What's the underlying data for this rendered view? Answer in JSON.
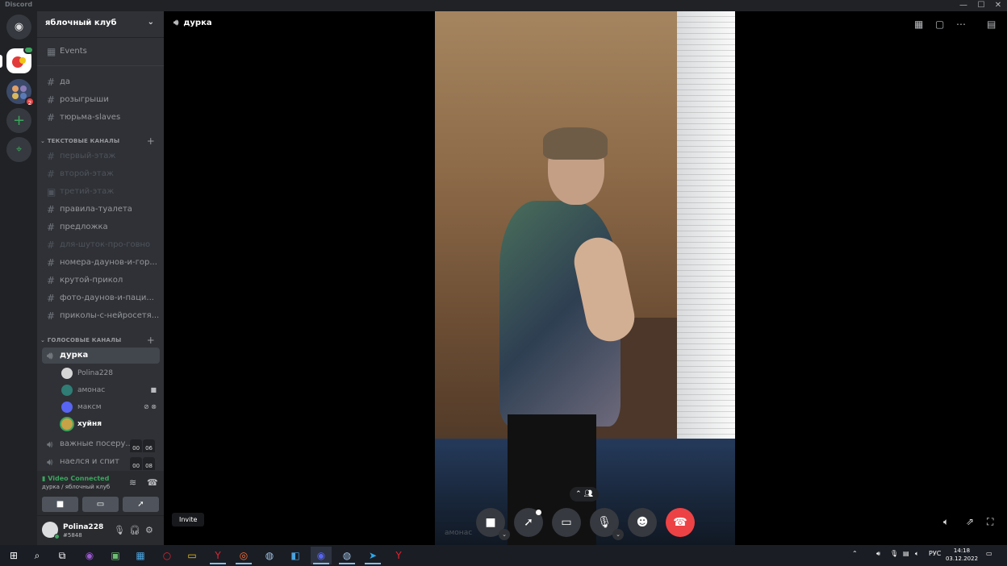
{
  "titlebar": {
    "app": "Discord",
    "minimize": "—",
    "maximize": "☐",
    "close": "✕"
  },
  "guilds": {
    "home": "◉",
    "add": "+",
    "explore": "⌖",
    "g2_badge": "2"
  },
  "server": {
    "name": "яблочный клуб",
    "chevron": "⌄"
  },
  "channels": {
    "events": "Events",
    "top": [
      "да",
      "розыгрыши",
      "тюрьма-slaves"
    ],
    "text_category": "ТЕКСТОВЫЕ КАНАЛЫ",
    "text": [
      "первый-этаж",
      "второй-этаж",
      "третий-этаж",
      "правила-туалета",
      "предложка",
      "для-шуток-про-говно",
      "номера-даунов-и-гор...",
      "крутой-прикол",
      "фото-даунов-и-паци...",
      "приколы-с-нейросетя..."
    ],
    "voice_category": "ГОЛОСОВЫЕ КАНАЛЫ",
    "voice_active": "дурка",
    "voice_users": [
      "Polina228",
      "амонас",
      "максм",
      "хуйня"
    ],
    "voice_other": [
      {
        "name": "важные посеру...",
        "a": "00",
        "b": "06"
      },
      {
        "name": "наелся и спит",
        "a": "00",
        "b": "08"
      }
    ]
  },
  "rtc": {
    "status": "Video Connected",
    "location": "дурка / яблочный клуб"
  },
  "user": {
    "name": "Polina228",
    "tag": "#5848"
  },
  "stage": {
    "channel": "дурка",
    "video_user": "амонас",
    "invite": "Invite"
  },
  "taskbar": {
    "lang": "РУС",
    "time": "14:18",
    "date": "03.12.2022"
  }
}
